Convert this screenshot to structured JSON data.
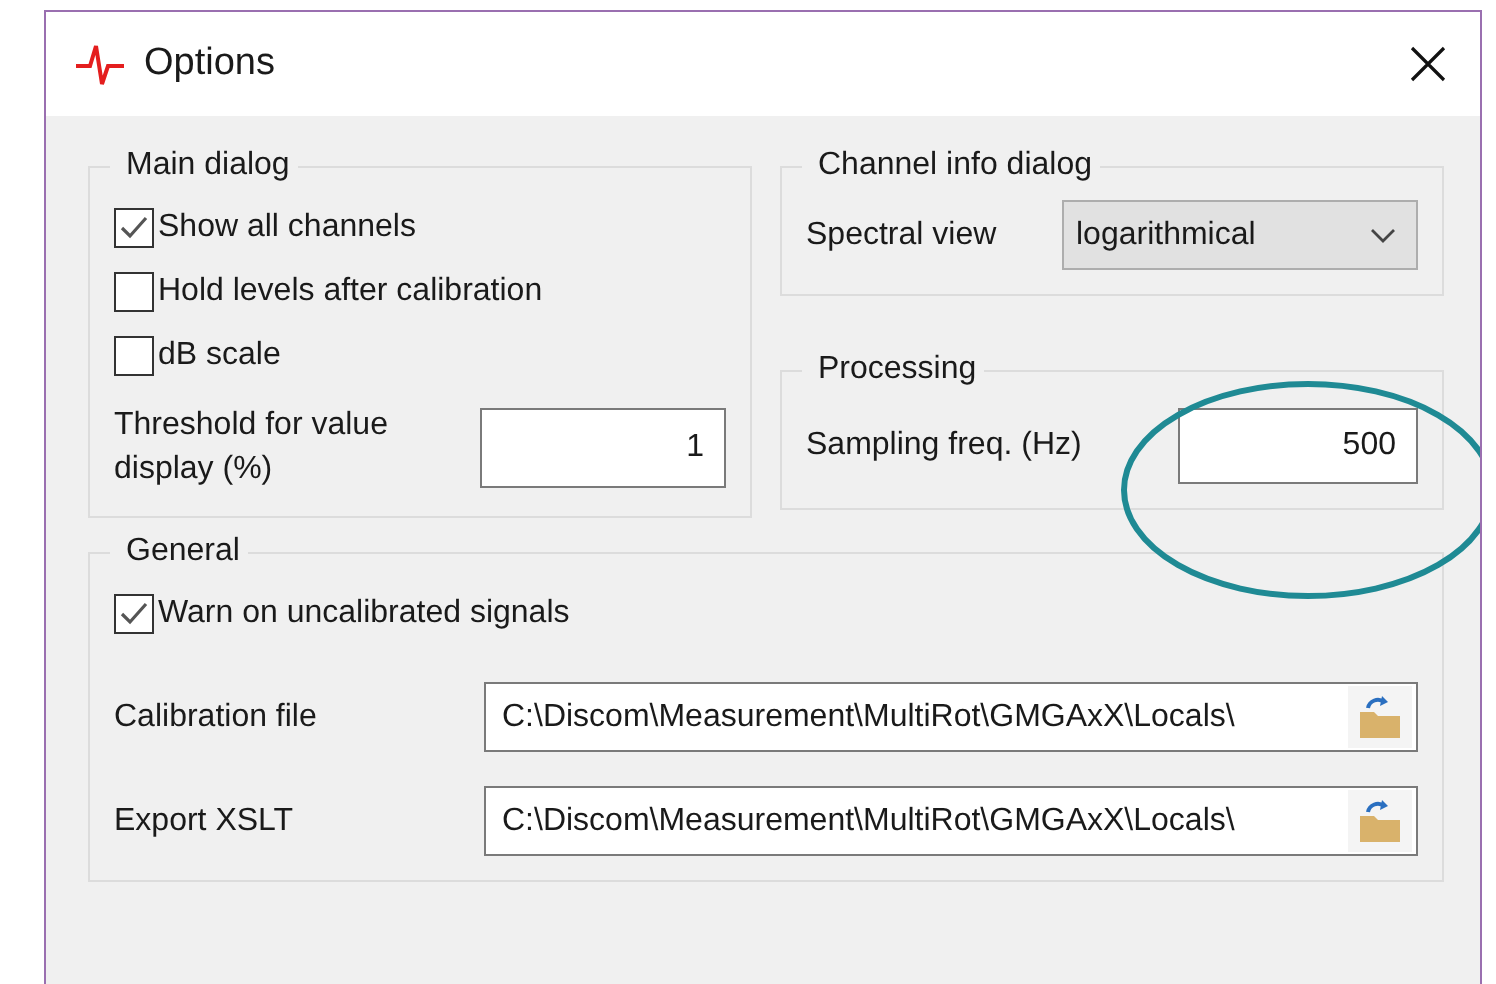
{
  "window": {
    "title": "Options"
  },
  "main_dialog": {
    "title": "Main dialog",
    "checkboxes": [
      {
        "label": "Show all channels",
        "checked": true
      },
      {
        "label": "Hold levels after calibration",
        "checked": false
      },
      {
        "label": "dB scale",
        "checked": false
      }
    ],
    "threshold": {
      "label": "Threshold for value display (%)",
      "value": "1"
    }
  },
  "channel_info_dialog": {
    "title": "Channel info dialog",
    "spectral_view": {
      "label": "Spectral view",
      "value": "logarithmical"
    }
  },
  "processing": {
    "title": "Processing",
    "sampling_freq": {
      "label": "Sampling freq. (Hz)",
      "value": "500"
    }
  },
  "general": {
    "title": "General",
    "warn": {
      "label": "Warn on uncalibrated signals",
      "checked": true
    },
    "files": [
      {
        "label": "Calibration file",
        "value": "C:\\Discom\\Measurement\\MultiRot\\GMGAxX\\Locals\\"
      },
      {
        "label": "Export XSLT",
        "value": "C:\\Discom\\Measurement\\MultiRot\\GMGAxX\\Locals\\"
      }
    ]
  }
}
